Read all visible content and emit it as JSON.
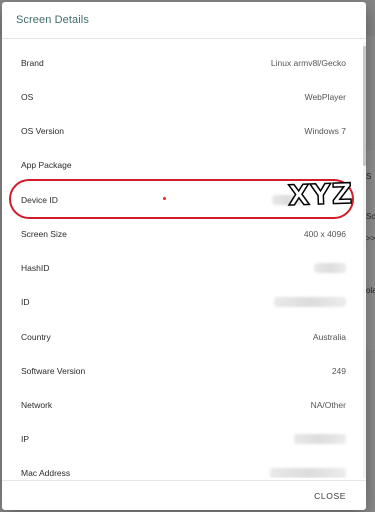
{
  "dialog": {
    "title": "Screen Details",
    "close_label": "CLOSE"
  },
  "rows": [
    {
      "label": "Brand",
      "value": "Linux armv8l/Gecko"
    },
    {
      "label": "OS",
      "value": "WebPlayer"
    },
    {
      "label": "OS Version",
      "value": "Windows 7"
    },
    {
      "label": "App Package",
      "value": ""
    },
    {
      "label": "Device ID",
      "value": ""
    },
    {
      "label": "Screen Size",
      "value": "400 x 4096"
    },
    {
      "label": "HashID",
      "value": ""
    },
    {
      "label": "ID",
      "value": ""
    },
    {
      "label": "Country",
      "value": "Australia"
    },
    {
      "label": "Software Version",
      "value": "249"
    },
    {
      "label": "Network",
      "value": "NA/Other"
    },
    {
      "label": "IP",
      "value": ""
    },
    {
      "label": "Mac Address",
      "value": ""
    }
  ],
  "annotation": {
    "stamp_text": "XYZ",
    "ring_color": "#d11c2a"
  },
  "background": {
    "fragments": [
      "S",
      "Sc",
      ">>",
      "ola"
    ]
  },
  "colors": {
    "title": "#3f6e6a",
    "overlay": "rgba(0,0,0,0.42)"
  }
}
